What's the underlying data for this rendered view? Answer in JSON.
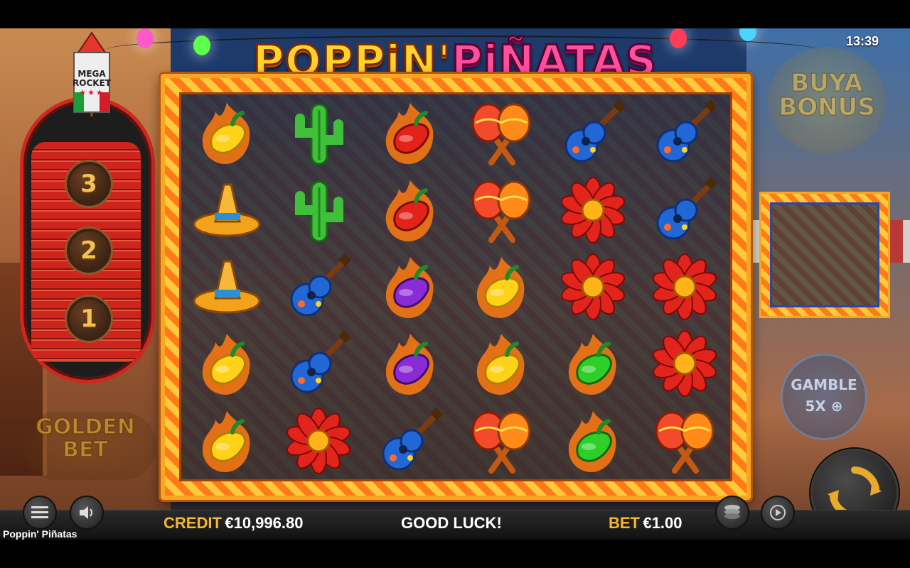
{
  "status": {
    "clock": "13:39"
  },
  "logo": {
    "part1": "POPPiN'",
    "part2": "PiÑATAS"
  },
  "rocket": {
    "label": "MEGA ROCKET",
    "stars": "★★★",
    "levels": [
      "3",
      "2",
      "1"
    ]
  },
  "features": {
    "golden_bet": "GOLDEN BET",
    "buy_bonus": "BUYA BONUS",
    "gamble_title": "GAMBLE",
    "gamble_multiplier": "5X"
  },
  "reels": {
    "rows": [
      [
        "yellow-pepper",
        "cactus",
        "red-pepper",
        "maracas",
        "guitar",
        "guitar"
      ],
      [
        "sombrero",
        "cactus",
        "red-pepper",
        "maracas",
        "flower",
        "guitar"
      ],
      [
        "sombrero",
        "guitar",
        "purple-pepper",
        "yellow-pepper",
        "flower",
        "flower"
      ],
      [
        "yellow-pepper",
        "guitar",
        "purple-pepper",
        "yellow-pepper",
        "green-pepper",
        "flower"
      ],
      [
        "yellow-pepper",
        "flower",
        "guitar",
        "maracas",
        "green-pepper",
        "maracas"
      ]
    ]
  },
  "bottom": {
    "credit_label": "CREDIT",
    "credit_value": "€10,996.80",
    "message": "GOOD LUCK!",
    "bet_label": "BET",
    "bet_value": "€1.00",
    "game_name": "Poppin' Piñatas"
  },
  "colors": {
    "accent": "#f5b731",
    "frame": "#f6a623",
    "rocket_red": "#d0281f"
  }
}
